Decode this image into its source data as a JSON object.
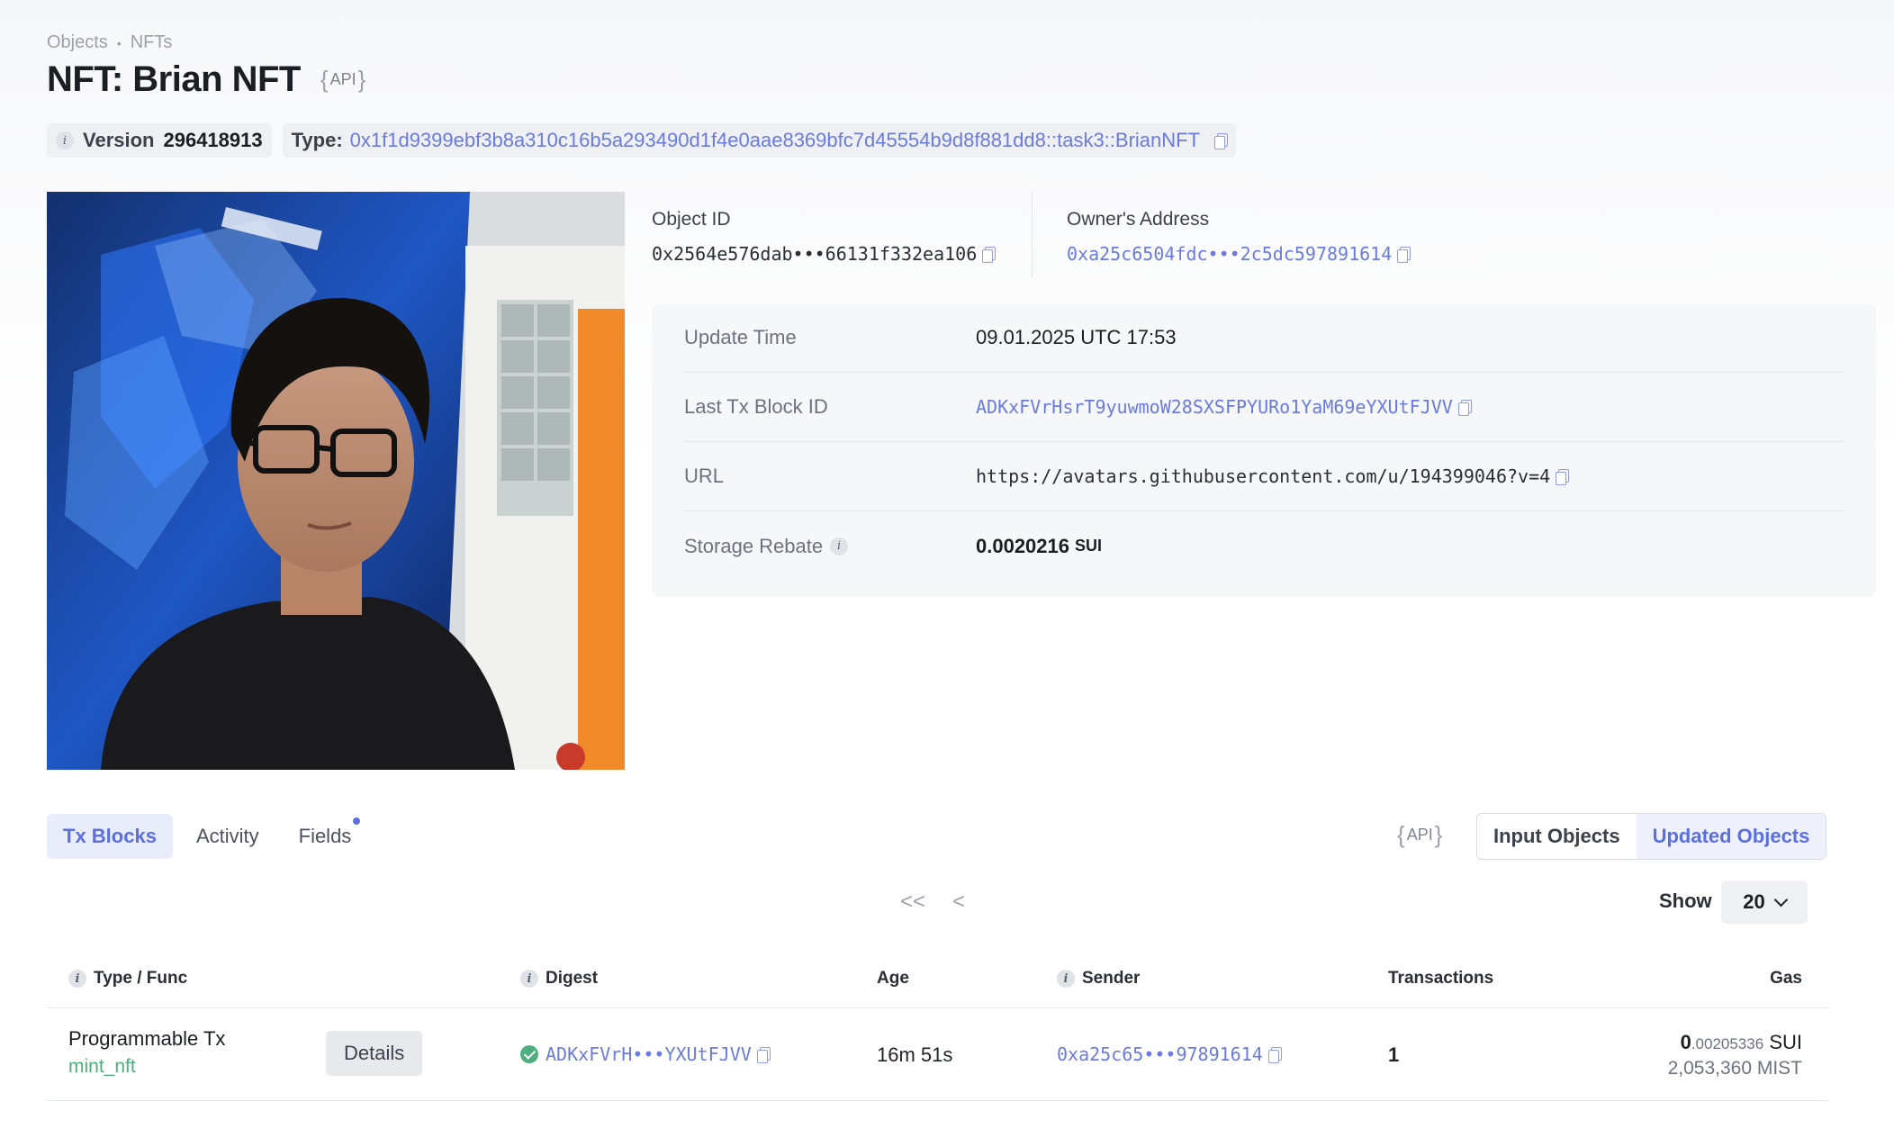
{
  "breadcrumb": {
    "level1": "Objects",
    "separator": "•",
    "level2": "NFTs"
  },
  "header": {
    "title": "NFT: Brian NFT",
    "api_left": "{",
    "api_label": "API",
    "api_right": "}"
  },
  "meta": {
    "version_label": "Version",
    "version_value": "296418913",
    "type_label": "Type:",
    "type_value": "0x1f1d9399ebf3b8a310c16b5a293490d1f4e0aae8369bfc7d45554b9d8f881dd8::task3::BrianNFT"
  },
  "object": {
    "id_label": "Object ID",
    "id_value": "0x2564e576dab•••66131f332ea106",
    "owner_label": "Owner's Address",
    "owner_value": "0xa25c6504fdc•••2c5dc597891614"
  },
  "details": {
    "update_time_label": "Update Time",
    "update_time_value": "09.01.2025 UTC 17:53",
    "last_tx_label": "Last Tx Block ID",
    "last_tx_value": "ADKxFVrHsrT9yuwmoW28SXSFPYURo1YaM69eYXUtFJVV",
    "url_label": "URL",
    "url_value": "https://avatars.githubusercontent.com/u/194399046?v=4",
    "storage_label": "Storage Rebate",
    "storage_value": "0.0020216",
    "storage_unit": "SUI"
  },
  "tabs": [
    "Tx Blocks",
    "Activity",
    "Fields"
  ],
  "segments": [
    "Input Objects",
    "Updated Objects"
  ],
  "pager": {
    "first": "<<",
    "prev": "<",
    "show_label": "Show",
    "show_value": "20"
  },
  "table": {
    "columns": [
      "Type / Func",
      "Digest",
      "Age",
      "Sender",
      "Transactions",
      "Gas"
    ],
    "rows": [
      {
        "type": "Programmable Tx",
        "func": "mint_nft",
        "details_label": "Details",
        "digest": "ADKxFVrH•••YXUtFJVV",
        "age": "16m 51s",
        "sender": "0xa25c65•••97891614",
        "transactions": "1",
        "gas_int": "0",
        "gas_frac": ".00205336",
        "gas_unit": "SUI",
        "gas_mist": "2,053,360 MIST"
      }
    ]
  },
  "colors": {
    "accent": "#5a6fe0",
    "link": "#6a7be0",
    "success": "#4caf7d"
  }
}
